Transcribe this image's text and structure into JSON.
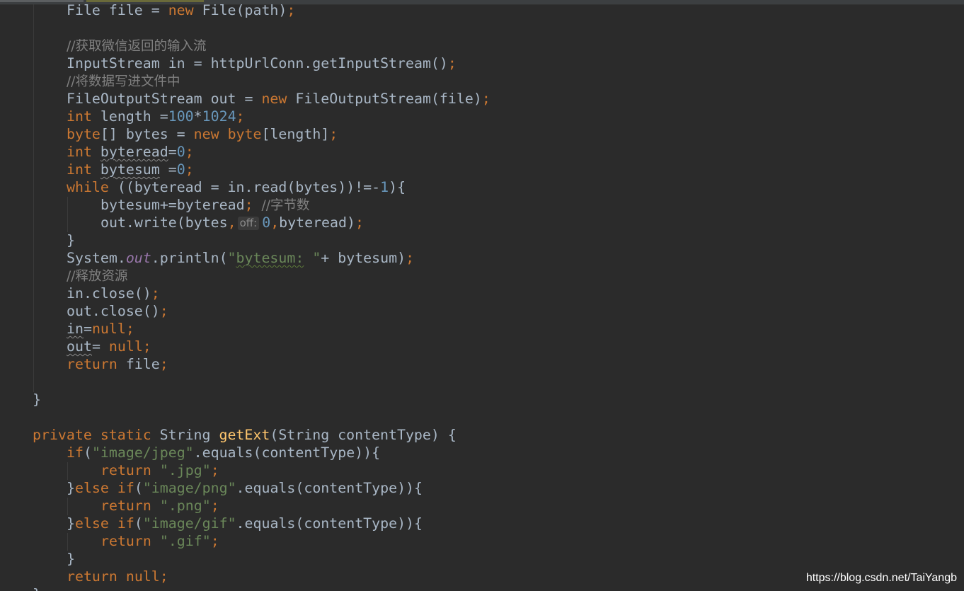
{
  "code": {
    "l1": [
      "File file = ",
      "new",
      " File(path)",
      ";"
    ],
    "l3": "//获取微信返回的输入流",
    "l4": [
      "InputStream in = httpUrlConn.getInputStream()",
      ";"
    ],
    "l5": "//将数据写进文件中",
    "l6": [
      "FileOutputStream out = ",
      "new",
      " FileOutputStream(file)",
      ";"
    ],
    "l7": [
      "int",
      " length =",
      "100",
      "*",
      "1024",
      ";"
    ],
    "l8": [
      "byte",
      "[] bytes = ",
      "new",
      " ",
      "byte",
      "[length]",
      ";"
    ],
    "l9": [
      "int",
      " ",
      "byteread",
      "=",
      "0",
      ";"
    ],
    "l10": [
      "int",
      " ",
      "bytesum",
      " =",
      "0",
      ";"
    ],
    "l11": [
      "while",
      " ((byteread = in.read(bytes))!=-",
      "1",
      "){"
    ],
    "l12": [
      "bytesum+=byteread",
      "; ",
      "//字节数"
    ],
    "l13": [
      "out.write(bytes",
      ",",
      "off:",
      "0",
      ",",
      "byteread)",
      ";"
    ],
    "l14": "}",
    "l15": [
      "System.",
      "out",
      ".println(",
      "\"",
      "bytesum:",
      " \"",
      "+ bytesum)",
      ";"
    ],
    "l16": "//释放资源",
    "l17": [
      "in.close()",
      ";"
    ],
    "l18": [
      "out.close()",
      ";"
    ],
    "l19": [
      "in",
      "=",
      "null",
      ";"
    ],
    "l20": [
      "out",
      "= ",
      "null",
      ";"
    ],
    "l21": [
      "return",
      " file",
      ";"
    ],
    "l23": "}",
    "l25": [
      "private",
      " ",
      "static",
      " String ",
      "getExt",
      "(String contentType) {"
    ],
    "l26": [
      "if",
      "(",
      "\"image/jpeg\"",
      ".equals(contentType)){"
    ],
    "l27": [
      "return",
      " ",
      "\".jpg\"",
      ";"
    ],
    "l28": [
      "}",
      "else",
      " ",
      "if",
      "(",
      "\"image/png\"",
      ".equals(contentType)){"
    ],
    "l29": [
      "return",
      " ",
      "\".png\"",
      ";"
    ],
    "l30": [
      "}",
      "else",
      " ",
      "if",
      "(",
      "\"image/gif\"",
      ".equals(contentType)){"
    ],
    "l31": [
      "return",
      " ",
      "\".gif\"",
      ";"
    ],
    "l32": "}",
    "l33": [
      "return",
      " ",
      "null",
      ";"
    ],
    "l34": "}"
  },
  "watermark": "https://blog.csdn.net/TaiYangb",
  "colors": {
    "background": "#2b2b2b",
    "text": "#a9b7c6",
    "keyword": "#cc7832",
    "number": "#6897bb",
    "string": "#6a8759",
    "comment": "#808080",
    "static_field": "#9876aa",
    "method_declaration": "#ffc66d"
  }
}
